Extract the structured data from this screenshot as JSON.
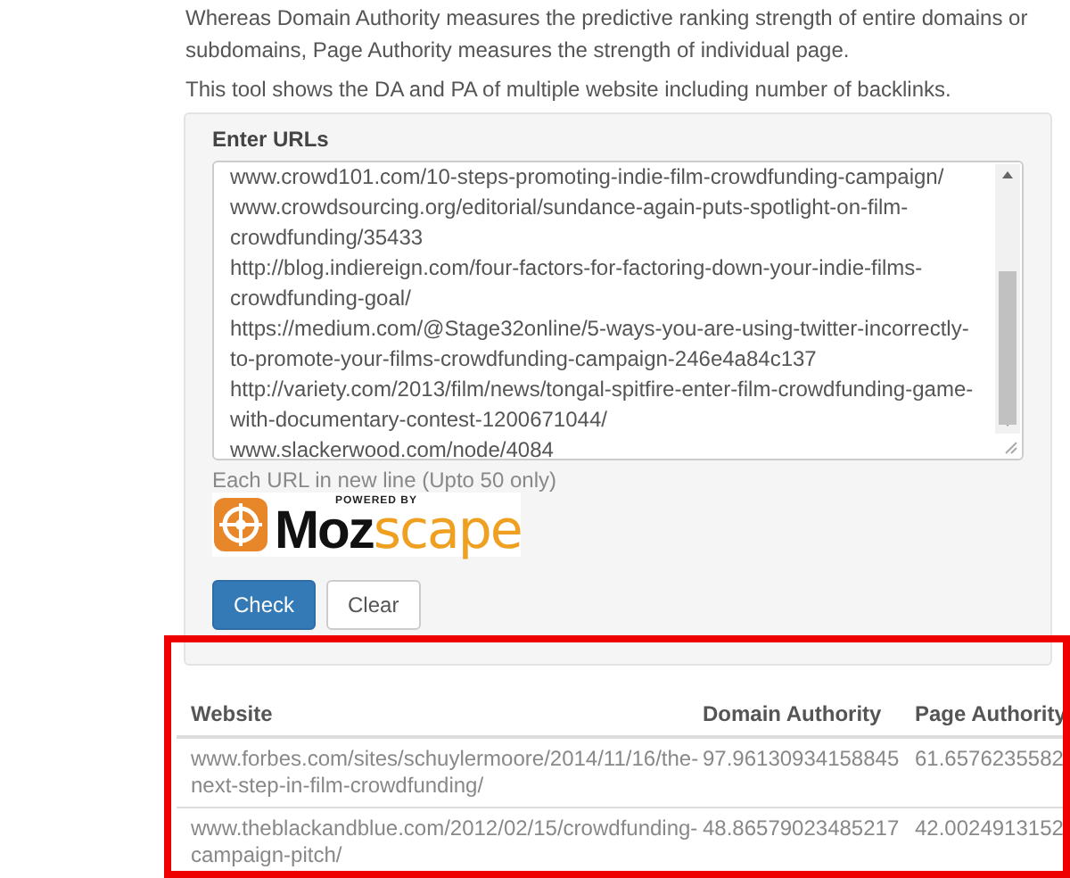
{
  "intro": [
    "Whereas Domain Authority measures the predictive ranking strength of entire domains or subdomains, Page Authority measures the strength of individual page.",
    "This tool shows the DA and PA of multiple website including number of backlinks."
  ],
  "form": {
    "label": "Enter URLs",
    "urls": [
      "www.crowd101.com/10-steps-promoting-indie-film-crowdfunding-campaign/",
      "www.crowdsourcing.org/editorial/sundance-again-puts-spotlight-on-film-crowdfunding/35433",
      "http://blog.indiereign.com/four-factors-for-factoring-down-your-indie-films-crowdfunding-goal/",
      "https://medium.com/@Stage32online/5-ways-you-are-using-twitter-incorrectly-to-promote-your-films-crowdfunding-campaign-246e4a84c137",
      "http://variety.com/2013/film/news/tongal-spitfire-enter-film-crowdfunding-game-with-documentary-contest-1200671044/",
      "www.slackerwood.com/node/4084"
    ],
    "help": "Each URL in new line (Upto 50 only)",
    "logo": {
      "powered_by": "POWERED BY",
      "brand": "Moz",
      "product": "scape"
    },
    "buttons": [
      {
        "label": "Check",
        "kind": "primary"
      },
      {
        "label": "Clear",
        "kind": "default"
      }
    ]
  },
  "results": {
    "highlighted": true,
    "columns": [
      "Website",
      "Domain Authority",
      "Page Authority"
    ],
    "rows": [
      [
        "www.forbes.com/sites/schuylermoore/2014/11/16/the-next-step-in-film-crowdfunding/",
        "97.96130934158845",
        "61.6576235582"
      ],
      [
        "www.theblackandblue.com/2012/02/15/crowdfunding-campaign-pitch/",
        "48.86579023485217",
        "42.0024913152"
      ]
    ]
  }
}
